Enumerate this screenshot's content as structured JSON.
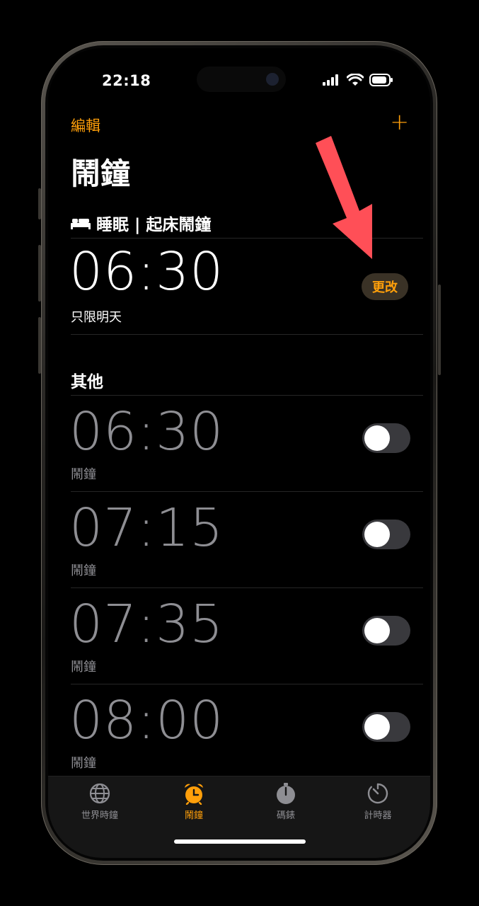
{
  "status": {
    "time": "22:18"
  },
  "header": {
    "edit_label": "編輯",
    "add_label": "+",
    "title": "鬧鐘"
  },
  "sleep": {
    "section_title": "睡眠 | 起床鬧鐘",
    "time": "06:30",
    "subtitle": "只限明天",
    "change_label": "更改"
  },
  "other": {
    "section_title": "其他",
    "alarms": [
      {
        "time": "06:30",
        "label": "鬧鐘",
        "enabled": false
      },
      {
        "time": "07:15",
        "label": "鬧鐘",
        "enabled": false
      },
      {
        "time": "07:35",
        "label": "鬧鐘",
        "enabled": false
      },
      {
        "time": "08:00",
        "label": "鬧鐘",
        "enabled": false
      }
    ]
  },
  "tabs": [
    {
      "label": "世界時鐘",
      "icon": "globe-icon",
      "active": false
    },
    {
      "label": "鬧鐘",
      "icon": "alarm-clock-icon",
      "active": true
    },
    {
      "label": "碼錶",
      "icon": "stopwatch-icon",
      "active": false
    },
    {
      "label": "計時器",
      "icon": "timer-icon",
      "active": false
    }
  ],
  "colors": {
    "accent": "#ff9f0a",
    "inactive": "#8e8e93",
    "annotation": "#ff4f57"
  }
}
